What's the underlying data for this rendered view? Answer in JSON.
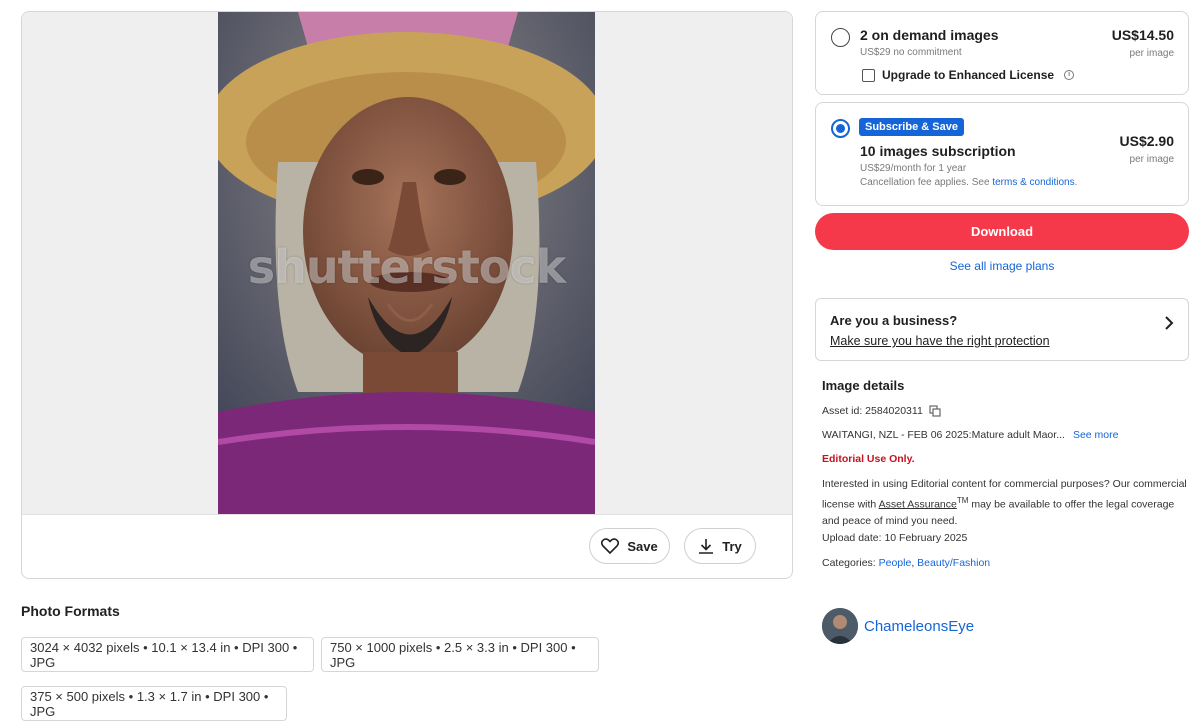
{
  "preview": {
    "watermark": "shutterstock",
    "save_label": "Save",
    "try_label": "Try"
  },
  "formats": {
    "title": "Photo Formats",
    "items": [
      "3024 × 4032 pixels • 10.1 × 13.4 in • DPI 300 • JPG",
      "750 × 1000 pixels • 2.5 × 3.3 in • DPI 300 • JPG",
      "375 × 500 pixels • 1.3 × 1.7 in • DPI 300 • JPG"
    ]
  },
  "plans": {
    "on_demand": {
      "title": "2 on demand images",
      "subtitle": "US$29 no commitment",
      "price": "US$14.50",
      "per": "per image",
      "upgrade_label": "Upgrade to Enhanced License"
    },
    "subscription": {
      "badge": "Subscribe & Save",
      "title": "10 images subscription",
      "subtitle": "US$29/month for 1 year",
      "fee_note": "Cancellation fee applies. See ",
      "terms_link": "terms & conditions",
      "fee_end": ".",
      "price": "US$2.90",
      "per": "per image"
    }
  },
  "download_label": "Download",
  "see_plans_label": "See all image plans",
  "business": {
    "title": "Are you a business?",
    "link": "Make sure you have the right protection"
  },
  "details": {
    "title": "Image details",
    "asset_id": "Asset id: 2584020311",
    "description": "WAITANGI, NZL - FEB 06 2025:Mature adult Maor...",
    "see_more": "See more",
    "editorial": "Editorial Use Only.",
    "interest_1": "Interested in using Editorial content for commercial purposes? Our commercial license with ",
    "asset_assurance": "Asset Assurance",
    "tm": "TM",
    "interest_2": " may be available to offer the legal coverage and peace of mind you need.",
    "upload": "Upload date: 10 February 2025",
    "categories_label": "Categories: ",
    "category_1": "People",
    "category_sep": ", ",
    "category_2": "Beauty/Fashion"
  },
  "contributor": {
    "name": "ChameleonsEye"
  },
  "colors": {
    "accent": "#1565d8",
    "download": "#f5394a",
    "editorial": "#c4121f"
  }
}
